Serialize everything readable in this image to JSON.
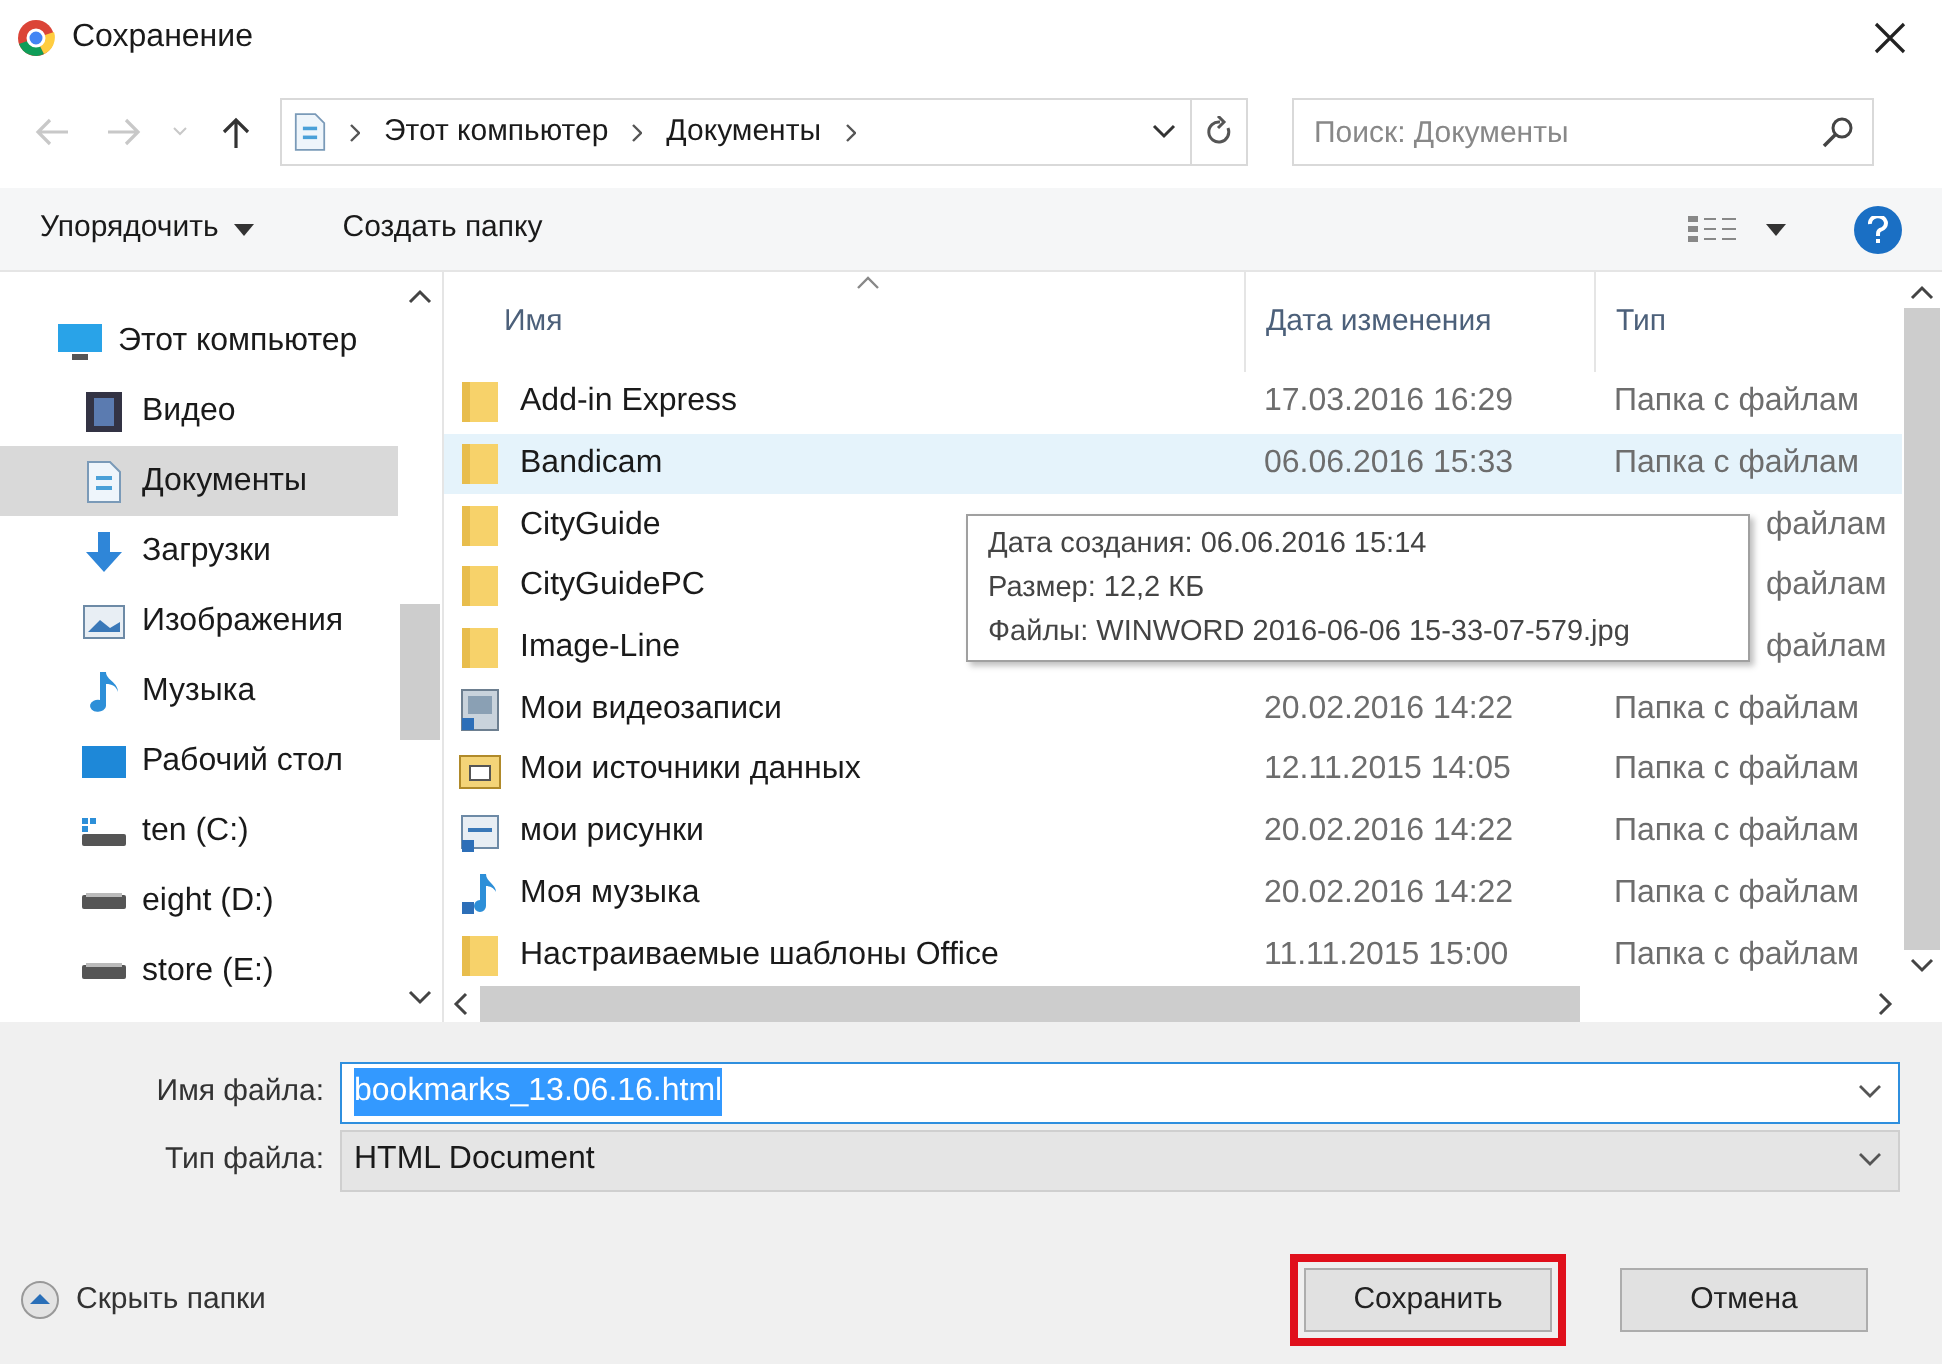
{
  "window": {
    "title": "Сохранение"
  },
  "address_bar": {
    "path": [
      "Этот компьютер",
      "Документы"
    ]
  },
  "search": {
    "placeholder": "Поиск: Документы"
  },
  "toolbar": {
    "organize": "Упорядочить",
    "new_folder": "Создать папку"
  },
  "sidebar": {
    "items": [
      {
        "label": "Этот компьютер",
        "kind": "computer",
        "selected": false,
        "children": [
          {
            "label": "Видео",
            "kind": "video",
            "selected": false
          },
          {
            "label": "Документы",
            "kind": "documents",
            "selected": true
          },
          {
            "label": "Загрузки",
            "kind": "downloads",
            "selected": false
          },
          {
            "label": "Изображения",
            "kind": "pictures",
            "selected": false
          },
          {
            "label": "Музыка",
            "kind": "music",
            "selected": false
          },
          {
            "label": "Рабочий стол",
            "kind": "desktop",
            "selected": false
          },
          {
            "label": "ten (C:)",
            "kind": "system_drive",
            "selected": false
          },
          {
            "label": "eight (D:)",
            "kind": "drive",
            "selected": false
          },
          {
            "label": "store (E:)",
            "kind": "drive",
            "selected": false
          }
        ]
      }
    ]
  },
  "file_list": {
    "columns": [
      "Имя",
      "Дата изменения",
      "Тип"
    ],
    "rows": [
      {
        "name": "Add-in Express",
        "kind": "folder",
        "date": "17.03.2016 16:29",
        "type": "Папка с файлам",
        "selected": false
      },
      {
        "name": "Bandicam",
        "kind": "folder",
        "date": "06.06.2016 15:33",
        "type": "Папка с файлам",
        "selected": true
      },
      {
        "name": "CityGuide",
        "kind": "folder",
        "type": "файлам",
        "selected": false
      },
      {
        "name": "CityGuidePC",
        "kind": "folder",
        "type": "файлам",
        "selected": false
      },
      {
        "name": "Image-Line",
        "kind": "folder",
        "type": "файлам",
        "selected": false
      },
      {
        "name": "Мои видеозаписи",
        "kind": "video_link",
        "date": "20.02.2016 14:22",
        "type": "Папка с файлам",
        "selected": false
      },
      {
        "name": "Мои источники данных",
        "kind": "data_folder",
        "date": "12.11.2015 14:05",
        "type": "Папка с файлам",
        "selected": false
      },
      {
        "name": "мои рисунки",
        "kind": "pictures_link",
        "date": "20.02.2016 14:22",
        "type": "Папка с файлам",
        "selected": false
      },
      {
        "name": "Моя музыка",
        "kind": "music_link",
        "date": "20.02.2016 14:22",
        "type": "Папка с файлам",
        "selected": false
      },
      {
        "name": "Настраиваемые шаблоны Office",
        "kind": "folder",
        "date": "11.11.2015 15:00",
        "type": "Папка с файлам",
        "selected": false
      }
    ]
  },
  "tooltip": {
    "lines": [
      "Дата создания: 06.06.2016 15:14",
      "Размер: 12,2 КБ",
      "Файлы: WINWORD 2016-06-06 15-33-07-579.jpg"
    ]
  },
  "file_name": {
    "label": "Имя файла:",
    "value": "bookmarks_13.06.16.html"
  },
  "file_type": {
    "label": "Тип файла:",
    "value": "HTML Document"
  },
  "hide_folders": "Скрыть папки",
  "buttons": [
    {
      "label": "Сохранить",
      "highlighted": true
    },
    {
      "label": "Отмена",
      "highlighted": false
    }
  ]
}
